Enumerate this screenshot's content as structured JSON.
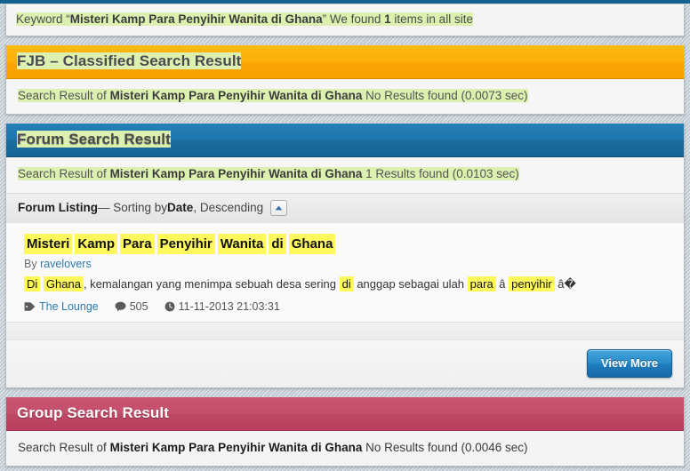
{
  "query": "Misteri Kamp Para Penyihir Wanita di Ghana",
  "keyword_bar": {
    "prefix": "Keyword “",
    "query": "Misteri Kamp Para Penyihir Wanita di Ghana",
    "middle": "” We found ",
    "count": "1",
    "suffix": " items in all site"
  },
  "sections": [
    {
      "id": "fjb",
      "title": "FJB – Classified Search Result",
      "accent": "#f9a706",
      "result_of_prefix": "Search Result of ",
      "result_of_query": "Misteri Kamp Para Penyihir Wanita di Ghana",
      "result_of_suffix": " No Results found (0.0073 sec)"
    },
    {
      "id": "forum",
      "title": "Forum Search Result",
      "accent": "#1a6b9f",
      "result_of_prefix": "Search Result of ",
      "result_of_query": "Misteri Kamp Para Penyihir Wanita di Ghana",
      "result_of_suffix": " 1 Results found (0.0103 sec)"
    },
    {
      "id": "group",
      "title": "Group Search Result",
      "accent": "#bd4764",
      "result_of_prefix": "Search Result of ",
      "result_of_query": "Misteri Kamp Para Penyihir Wanita di Ghana",
      "result_of_suffix": " No Results found (0.0046 sec)"
    }
  ],
  "listing": {
    "label": "Forum Listing",
    "dash": " — Sorting by ",
    "sort_field": "Date",
    "sort_order": ", Descending",
    "toggle_icon": "chevron-up-icon"
  },
  "result": {
    "title_keywords": [
      "Misteri",
      "Kamp",
      "Para",
      "Penyihir",
      "Wanita",
      "di",
      "Ghana"
    ],
    "by_label": "By ",
    "author": "ravelovers",
    "snippet": {
      "k1": "Di",
      "k2": "Ghana",
      "t1": ", kemalangan yang menimpa sebuah desa sering ",
      "k3": "di",
      "t2": " anggap sebagai ulah ",
      "k4": "para",
      "t3": " â ",
      "k5": "penyihir",
      "t4": " â�"
    },
    "forum_name": "The Lounge",
    "views": "505",
    "timestamp": "11-11-2013 21:03:31",
    "icons": {
      "tag": "tag-icon",
      "comment": "comment-icon",
      "clock": "clock-icon"
    }
  },
  "view_more_label": "View More"
}
